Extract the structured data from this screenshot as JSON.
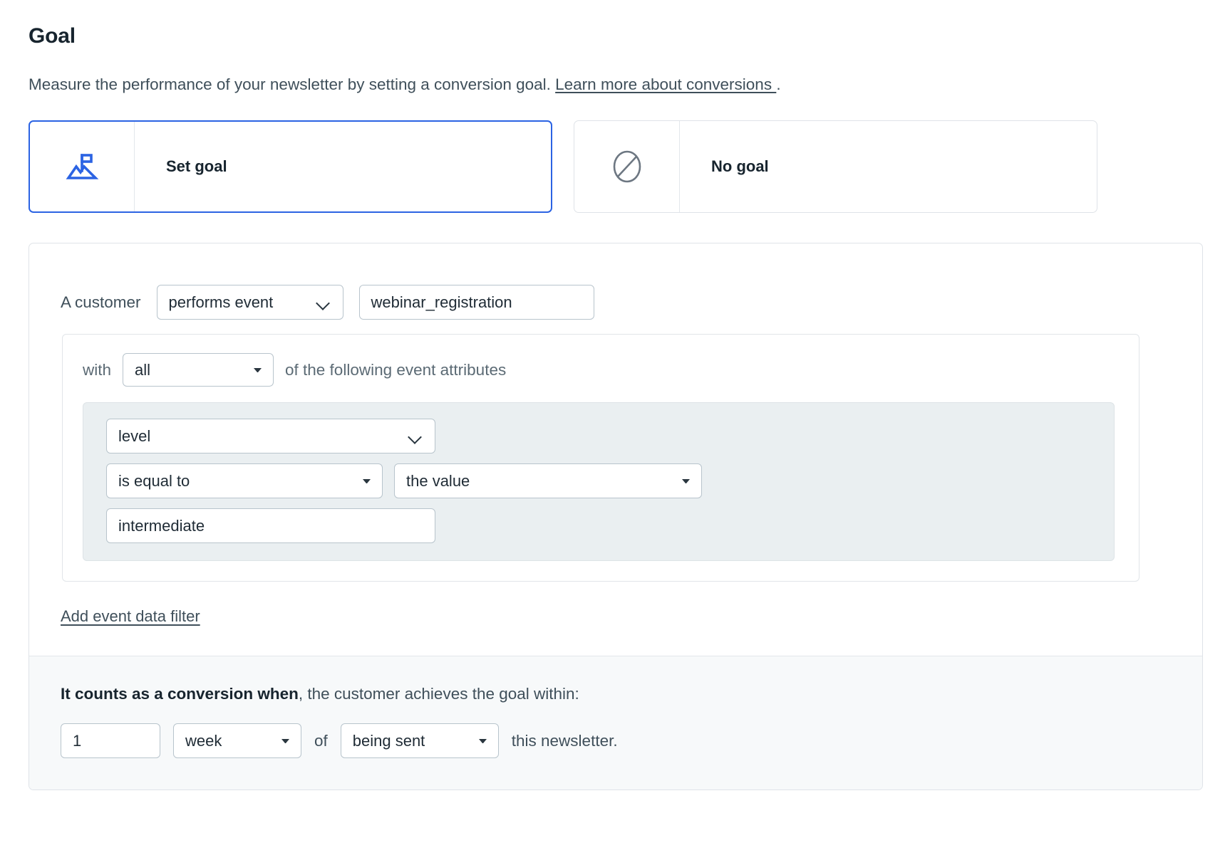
{
  "header": {
    "title": "Goal",
    "description_before": "Measure the performance of your newsletter by setting a conversion goal. ",
    "link_text": "Learn more about conversions ",
    "description_after": "."
  },
  "choices": [
    {
      "label": "Set goal",
      "icon": "mountain-flag-icon",
      "selected": true
    },
    {
      "label": "No goal",
      "icon": "no-entry-icon",
      "selected": false
    }
  ],
  "goal_builder": {
    "subject_label": "A customer",
    "event_type": "performs event",
    "event_name": "webinar_registration",
    "attributes": {
      "with_label": "with",
      "match_mode": "all",
      "trailing_label": "of the following event attributes",
      "rows": [
        {
          "attribute": "level",
          "operator": "is equal to",
          "value_kind": "the value",
          "value": "intermediate"
        }
      ]
    },
    "add_filter_label": "Add event data filter"
  },
  "conversion": {
    "strong_text": "It counts as a conversion when",
    "sentence_rest": ", the customer achieves the goal within:",
    "amount": "1",
    "unit": "week",
    "of_label": "of",
    "trigger": "being sent",
    "tail_label": "this newsletter."
  },
  "colors": {
    "accent": "#2b63e3",
    "text": "#17242e",
    "muted": "#3f4f5a",
    "field_border": "#b8c4cc",
    "group_bg": "#eaeff1"
  }
}
